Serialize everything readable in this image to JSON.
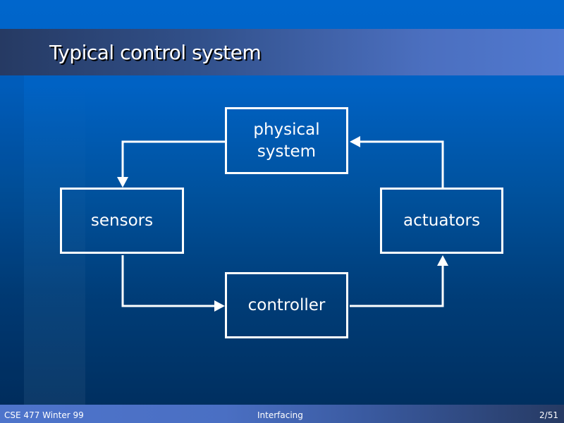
{
  "slide": {
    "title": "Typical control system",
    "footer": {
      "left": "CSE 477 Winter 99",
      "center": "Interfacing",
      "right": "2/51"
    }
  },
  "diagram": {
    "nodes": {
      "physical_system": "physical\nsystem",
      "sensors": "sensors",
      "actuators": "actuators",
      "controller": "controller"
    },
    "edges": [
      {
        "from": "physical system",
        "to": "sensors"
      },
      {
        "from": "sensors",
        "to": "controller"
      },
      {
        "from": "controller",
        "to": "actuators"
      },
      {
        "from": "actuators",
        "to": "physical system"
      }
    ]
  },
  "colors": {
    "background_top": "#0066cc",
    "background_bottom": "#002d5c",
    "foreground": "#ffffff"
  }
}
